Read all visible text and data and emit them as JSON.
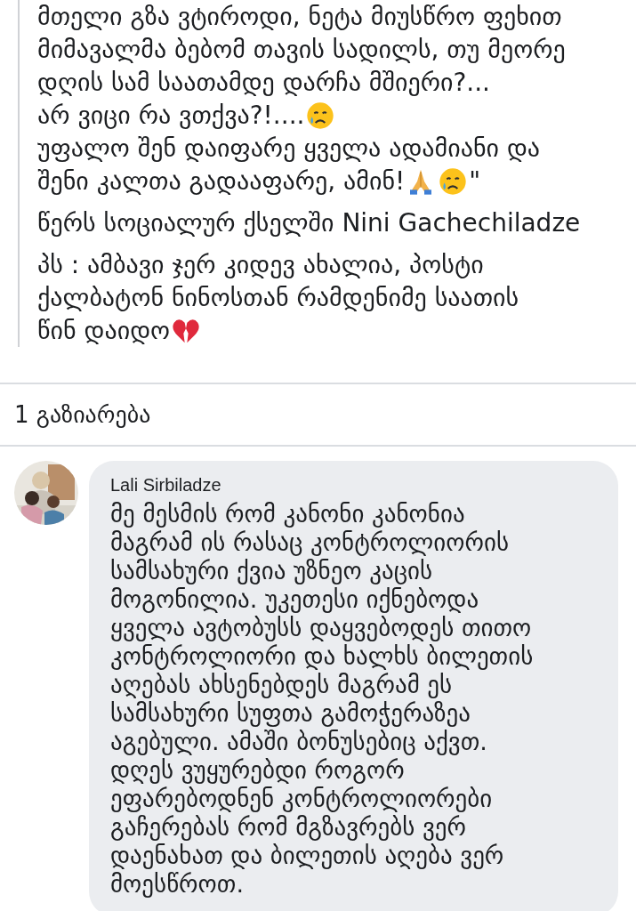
{
  "post": {
    "paragraphs": [
      [
        [
          {
            "kind": "text",
            "text": "მთელი გზა ვტიროდი, ნეტა მიუსწრო ფეხით"
          }
        ],
        [
          {
            "kind": "text",
            "text": "მიმავალმა ბებომ თავის სადილს, თუ მეორე"
          }
        ],
        [
          {
            "kind": "text",
            "text": "დღის სამ საათამდე დარჩა მშიერი?..."
          }
        ],
        [
          {
            "kind": "text",
            "text": "არ ვიცი რა ვთქვა?!...."
          },
          {
            "kind": "crying-face"
          }
        ],
        [
          {
            "kind": "text",
            "text": "უფალო შენ დაიფარე ყველა ადამიანი და"
          }
        ],
        [
          {
            "kind": "text",
            "text": "შენი კალთა გადააფარე, ამინ!"
          },
          {
            "kind": "praying-hands"
          },
          {
            "kind": "crying-face"
          },
          {
            "kind": "text",
            "text": "\""
          }
        ]
      ],
      [
        [
          {
            "kind": "text",
            "text": "წერს სოციალურ ქსელში Nini Gachechiladze"
          }
        ]
      ],
      [
        [
          {
            "kind": "text",
            "text": "პს : ამბავი ჯერ კიდევ ახალია, პოსტი"
          }
        ],
        [
          {
            "kind": "text",
            "text": "ქალბატონ ნინოსთან რამდენიმე საათის"
          }
        ],
        [
          {
            "kind": "text",
            "text": "წინ დაიდო"
          },
          {
            "kind": "broken-heart"
          }
        ]
      ]
    ]
  },
  "shares": "1 გაზიარება",
  "comment": {
    "author": "Lali Sirbiladze",
    "text": "მე მესმის რომ კანონი კანონია\nმაგრამ ის რასაც კონტროლიორის\nსამსახური ქვია უზნეო კაცის\nმოგონილია. უკეთესი იქნებოდა\nყველა ავტობუსს დაყვებოდეს თითო\nკონტროლიორი და ხალხს ბილეთის\nაღებას ახსენებდეს მაგრამ ეს\nსამსახური სუფთა გამოჭერაზეა\nაგებული. ამაში ბონუსებიც აქვთ.\nდღეს ვუყურებდი როგორ\nეფარებოდნენ კონტროლიორები\nგაჩერებას რომ მგზავრებს ვერ\nდაენახათ და ბილეთის აღება ვერ\nმოესწროთ."
  }
}
